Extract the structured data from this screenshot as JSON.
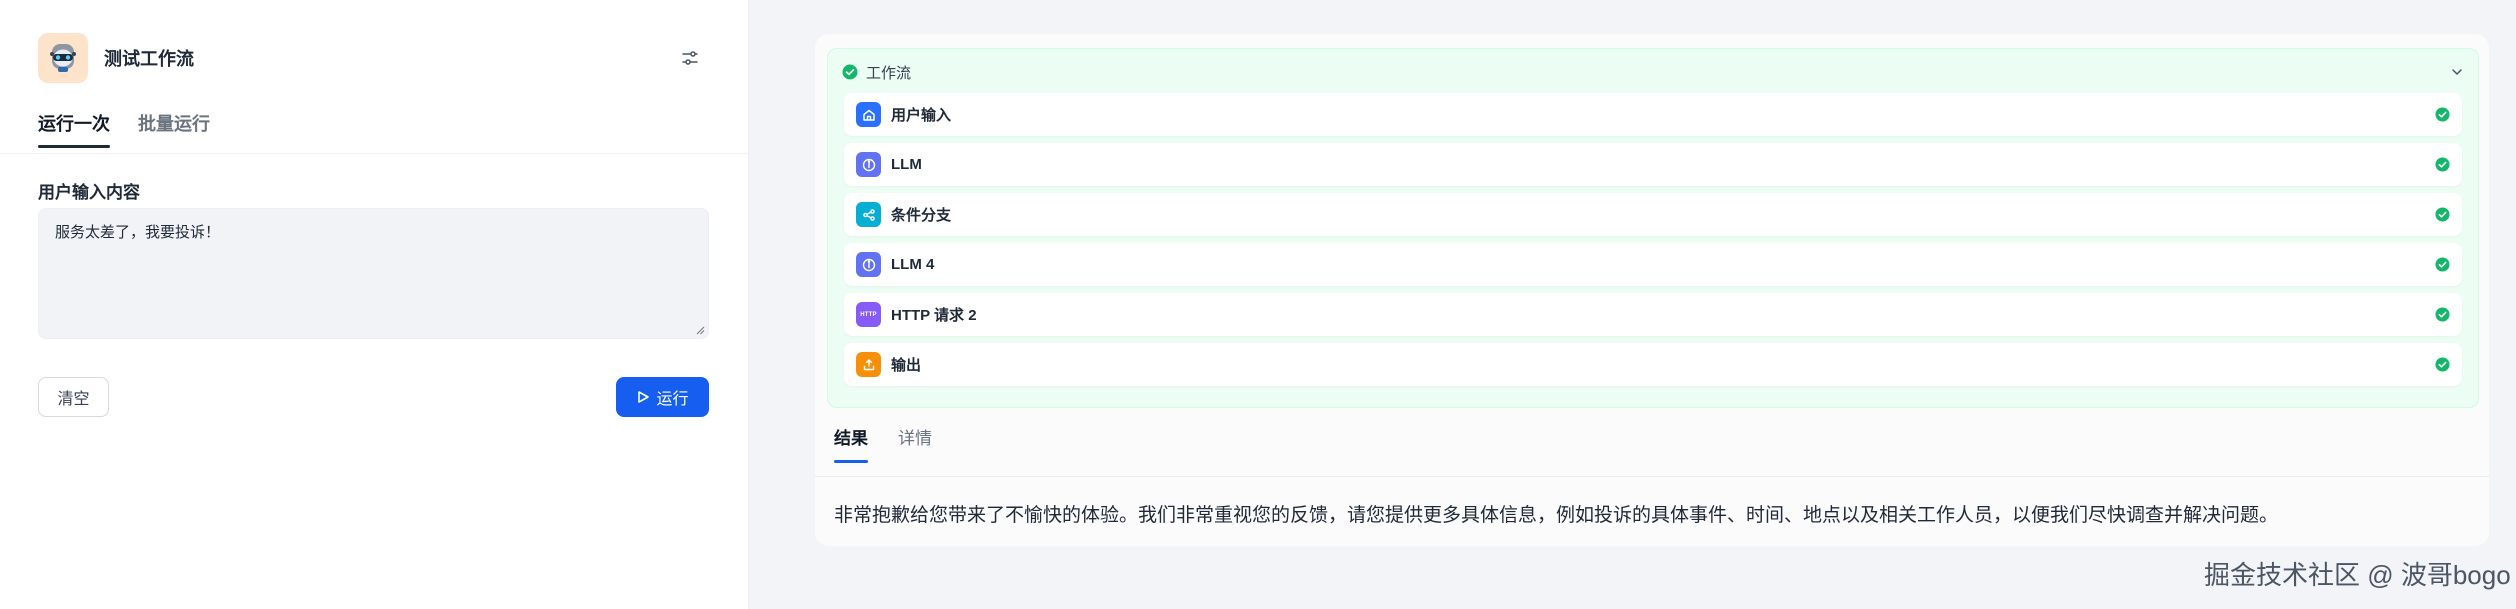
{
  "app": {
    "title": "测试工作流",
    "icon": "robot-avatar-icon"
  },
  "left_tabs": [
    {
      "label": "运行一次",
      "active": true
    },
    {
      "label": "批量运行",
      "active": false
    }
  ],
  "form": {
    "field_label": "用户输入内容",
    "input_value": "服务太差了，我要投诉！",
    "clear_label": "清空",
    "run_label": "运行"
  },
  "workflow": {
    "header_title": "工作流",
    "status": "success",
    "nodes": [
      {
        "title": "用户输入",
        "icon": "home-icon",
        "icon_color": "#2970ff",
        "status": "success"
      },
      {
        "title": "LLM",
        "icon": "llm-icon",
        "icon_color": "#6172f3",
        "status": "success"
      },
      {
        "title": "条件分支",
        "icon": "branch-icon",
        "icon_color": "#06aed4",
        "status": "success"
      },
      {
        "title": "LLM 4",
        "icon": "llm-icon",
        "icon_color": "#6172f3",
        "status": "success"
      },
      {
        "title": "HTTP 请求 2",
        "icon": "http-icon",
        "icon_label": "HTTP",
        "icon_color": "#875bf7",
        "status": "success"
      },
      {
        "title": "输出",
        "icon": "output-icon",
        "icon_color": "#f79009",
        "status": "success"
      }
    ]
  },
  "result_tabs": [
    {
      "label": "结果",
      "active": true
    },
    {
      "label": "详情",
      "active": false
    }
  ],
  "result_text": "非常抱歉给您带来了不愉快的体验。我们非常重视您的反馈，请您提供更多具体信息，例如投诉的具体事件、时间、地点以及相关工作人员，以便我们尽快调查并解决问题。",
  "watermark": "掘金技术社区 @ 波哥bogo",
  "colors": {
    "primary": "#155eef",
    "success": "#12b76a",
    "success_bg": "#ecfdf3"
  }
}
